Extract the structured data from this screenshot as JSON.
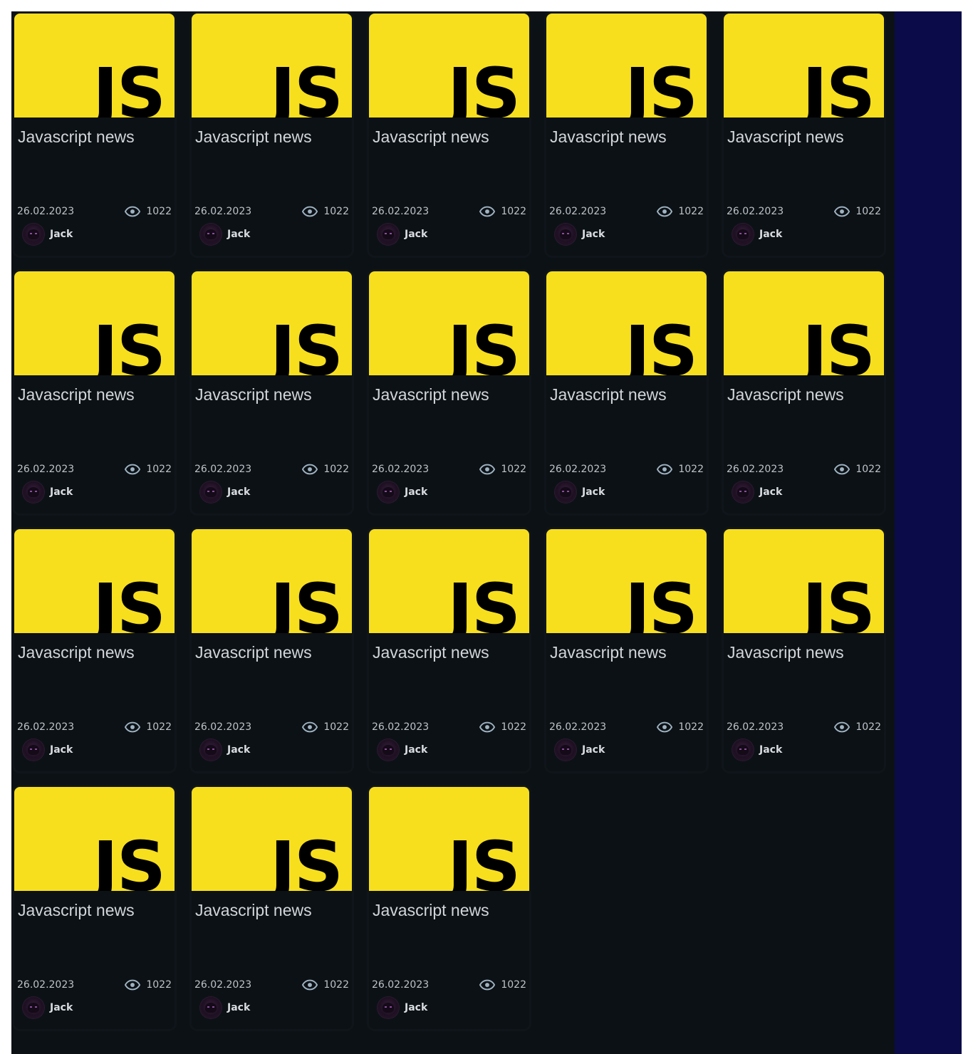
{
  "colors": {
    "thumb_bg": "#f7df1e",
    "card_bg": "#0c1115",
    "sidebar_bg": "#0a0b48"
  },
  "articles": [
    {
      "logo_text": "JS",
      "title": "Javascript news",
      "date": "26.02.2023",
      "views": "1022",
      "author": "Jack"
    },
    {
      "logo_text": "JS",
      "title": "Javascript news",
      "date": "26.02.2023",
      "views": "1022",
      "author": "Jack"
    },
    {
      "logo_text": "JS",
      "title": "Javascript news",
      "date": "26.02.2023",
      "views": "1022",
      "author": "Jack"
    },
    {
      "logo_text": "JS",
      "title": "Javascript news",
      "date": "26.02.2023",
      "views": "1022",
      "author": "Jack"
    },
    {
      "logo_text": "JS",
      "title": "Javascript news",
      "date": "26.02.2023",
      "views": "1022",
      "author": "Jack"
    },
    {
      "logo_text": "JS",
      "title": "Javascript news",
      "date": "26.02.2023",
      "views": "1022",
      "author": "Jack"
    },
    {
      "logo_text": "JS",
      "title": "Javascript news",
      "date": "26.02.2023",
      "views": "1022",
      "author": "Jack"
    },
    {
      "logo_text": "JS",
      "title": "Javascript news",
      "date": "26.02.2023",
      "views": "1022",
      "author": "Jack"
    },
    {
      "logo_text": "JS",
      "title": "Javascript news",
      "date": "26.02.2023",
      "views": "1022",
      "author": "Jack"
    },
    {
      "logo_text": "JS",
      "title": "Javascript news",
      "date": "26.02.2023",
      "views": "1022",
      "author": "Jack"
    },
    {
      "logo_text": "JS",
      "title": "Javascript news",
      "date": "26.02.2023",
      "views": "1022",
      "author": "Jack"
    },
    {
      "logo_text": "JS",
      "title": "Javascript news",
      "date": "26.02.2023",
      "views": "1022",
      "author": "Jack"
    },
    {
      "logo_text": "JS",
      "title": "Javascript news",
      "date": "26.02.2023",
      "views": "1022",
      "author": "Jack"
    },
    {
      "logo_text": "JS",
      "title": "Javascript news",
      "date": "26.02.2023",
      "views": "1022",
      "author": "Jack"
    },
    {
      "logo_text": "JS",
      "title": "Javascript news",
      "date": "26.02.2023",
      "views": "1022",
      "author": "Jack"
    },
    {
      "logo_text": "JS",
      "title": "Javascript news",
      "date": "26.02.2023",
      "views": "1022",
      "author": "Jack"
    },
    {
      "logo_text": "JS",
      "title": "Javascript news",
      "date": "26.02.2023",
      "views": "1022",
      "author": "Jack"
    },
    {
      "logo_text": "JS",
      "title": "Javascript news",
      "date": "26.02.2023",
      "views": "1022",
      "author": "Jack"
    }
  ]
}
